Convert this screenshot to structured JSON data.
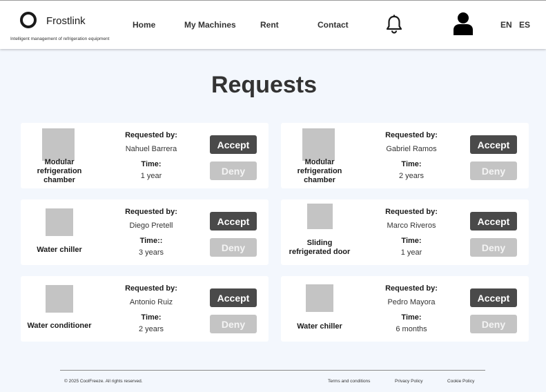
{
  "header": {
    "brand": "Frostlink",
    "tagline": "Intelligent management of refrigeration equipment",
    "nav": [
      "Home",
      "My Machines",
      "Rent",
      "Contact"
    ],
    "languages": [
      "EN",
      "ES"
    ]
  },
  "page": {
    "title": "Requests"
  },
  "labels": {
    "requested_by": "Requested by:",
    "time": "Time:",
    "time_alt": "Time::",
    "accept": "Accept",
    "deny": "Deny"
  },
  "requests": [
    {
      "machine": "Modular refrigeration chamber",
      "requester": "Nahuel Barrera",
      "time_label": "Time:",
      "duration": "1 year"
    },
    {
      "machine": "Modular refrigeration chamber",
      "requester": "Gabriel Ramos",
      "time_label": "Time:",
      "duration": "2 years"
    },
    {
      "machine": "Water chiller",
      "requester": "Diego Pretell",
      "time_label": "Time::",
      "duration": "3 years"
    },
    {
      "machine": "Sliding refrigerated door",
      "requester": "Marco Riveros",
      "time_label": "Time:",
      "duration": "1 year"
    },
    {
      "machine": "Water conditioner",
      "requester": "Antonio Ruiz",
      "time_label": "Time:",
      "duration": "2 years"
    },
    {
      "machine": "Water chiller",
      "requester": "Pedro Mayora",
      "time_label": "Time:",
      "duration": "6 months"
    }
  ],
  "footer": {
    "copyright": "© 2025 CoolFreeze. All rights reserved.",
    "links": [
      "Terms and conditions",
      "Privacy Policy",
      "Cookie Policy"
    ]
  },
  "colors": {
    "background": "#f3f7fd",
    "accept": "#4a4a4a",
    "deny": "#c4c4c4",
    "thumbnail": "#c4c4c4"
  },
  "icons": {
    "logo": "ring-logo-icon",
    "notifications": "bell-icon",
    "account": "user-icon"
  }
}
